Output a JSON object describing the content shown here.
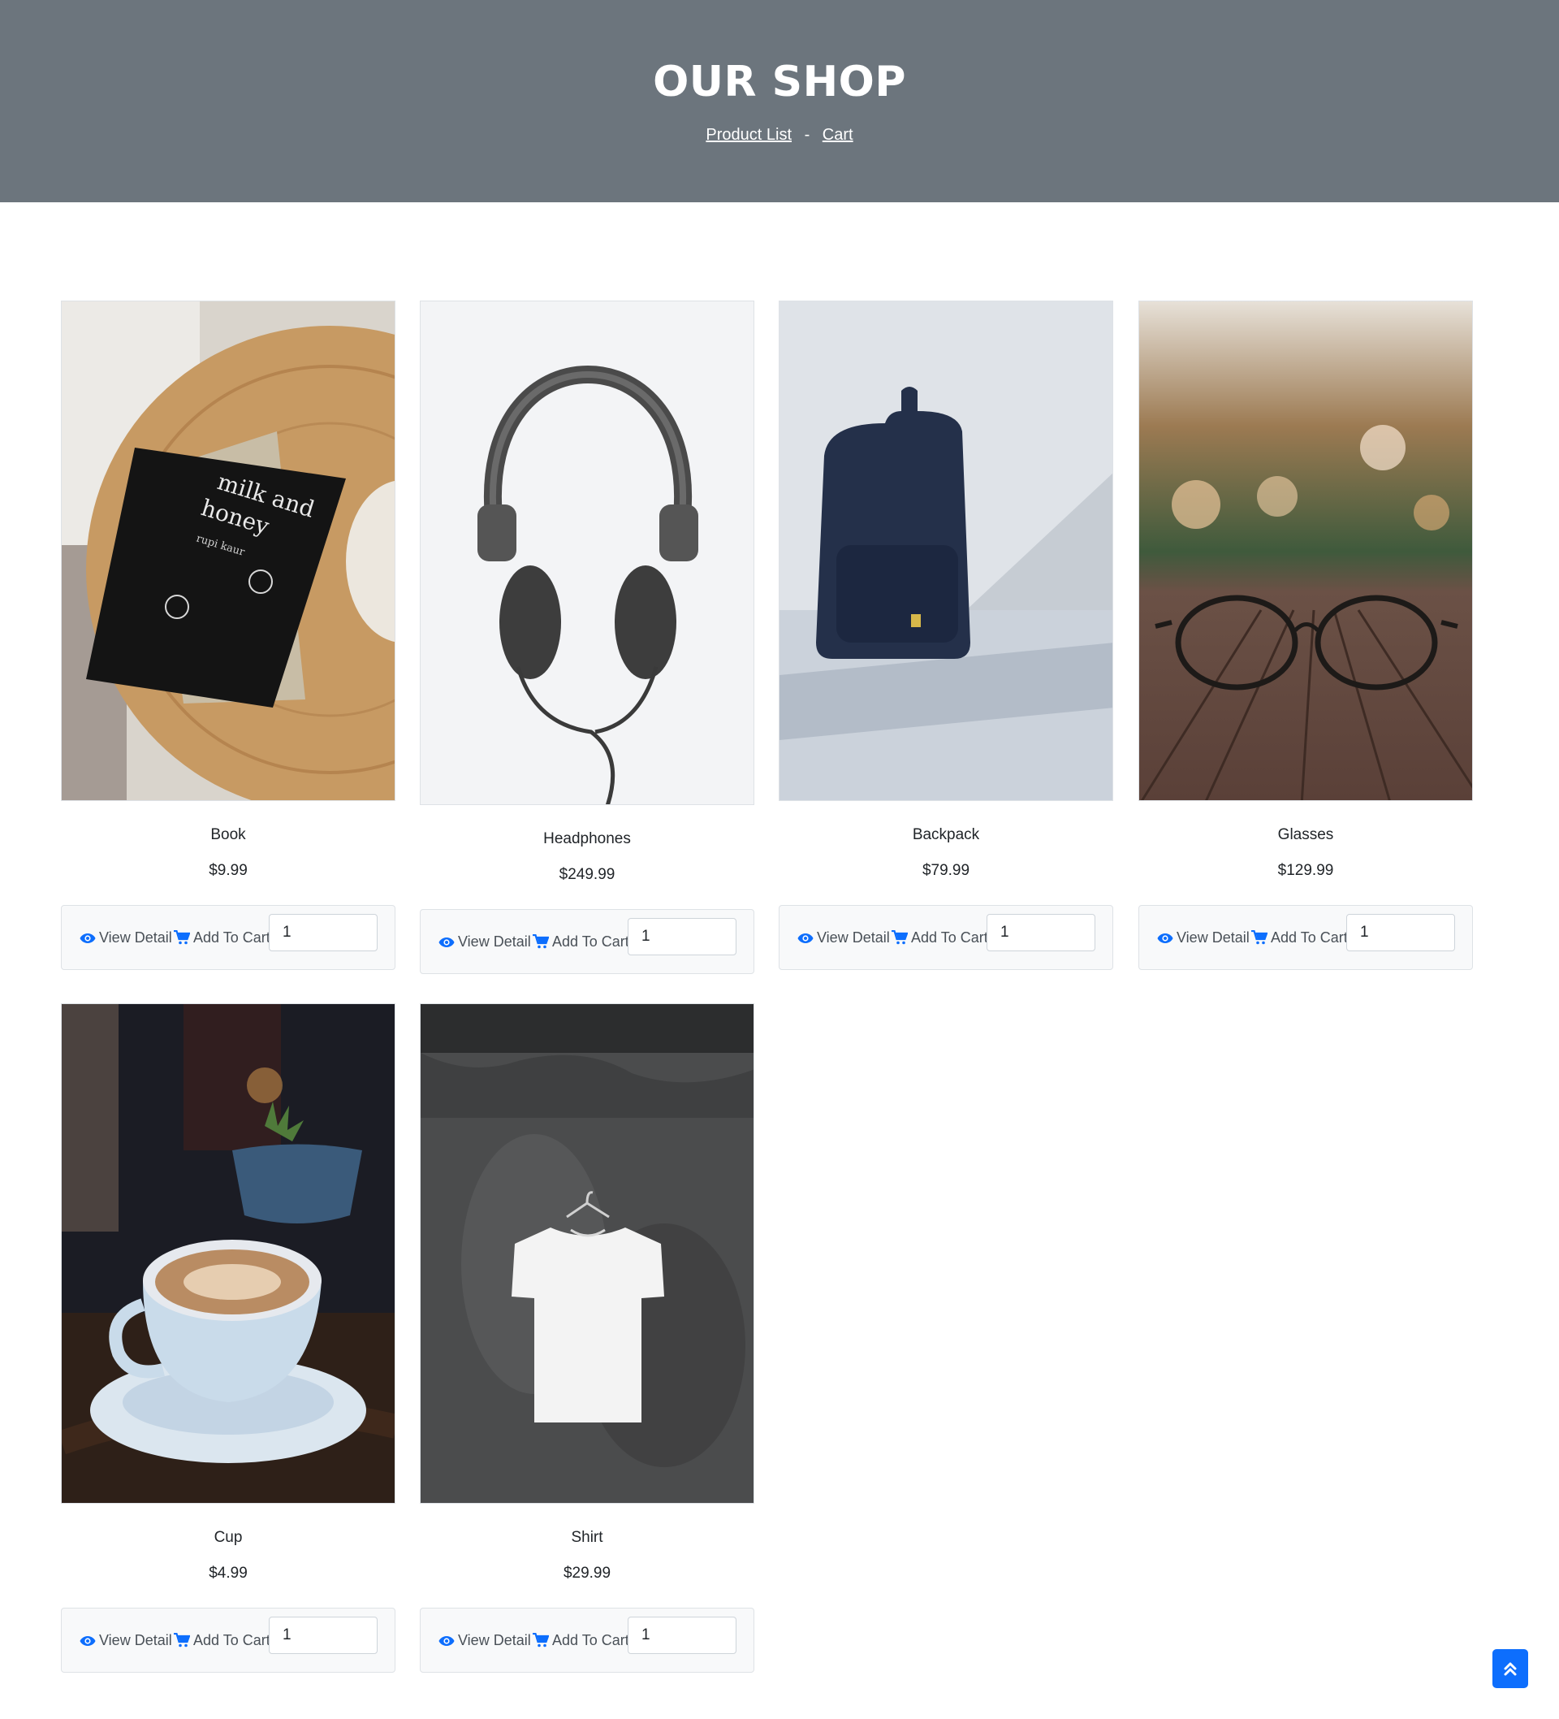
{
  "header": {
    "title": "OUR SHOP",
    "breadcrumb": {
      "product_list": "Product List",
      "separator": "-",
      "cart": "Cart"
    }
  },
  "product_actions": {
    "view_detail": "View Detail",
    "add_to_cart": "Add To Cart"
  },
  "products": [
    {
      "name": "Book",
      "price": "$9.99",
      "quantity": "1",
      "icon": "book-photo"
    },
    {
      "name": "Headphones",
      "price": "$249.99",
      "quantity": "1",
      "icon": "headphones-photo"
    },
    {
      "name": "Backpack",
      "price": "$79.99",
      "quantity": "1",
      "icon": "backpack-photo"
    },
    {
      "name": "Glasses",
      "price": "$129.99",
      "quantity": "1",
      "icon": "glasses-photo"
    },
    {
      "name": "Cup",
      "price": "$4.99",
      "quantity": "1",
      "icon": "cup-photo"
    },
    {
      "name": "Shirt",
      "price": "$29.99",
      "quantity": "1",
      "icon": "shirt-photo"
    }
  ],
  "colors": {
    "header_bg": "#6c757d",
    "accent": "#0d6efd"
  },
  "icons": {
    "view": "eye-icon",
    "cart": "cart-icon",
    "scroll_top": "double-chevron-up-icon"
  }
}
